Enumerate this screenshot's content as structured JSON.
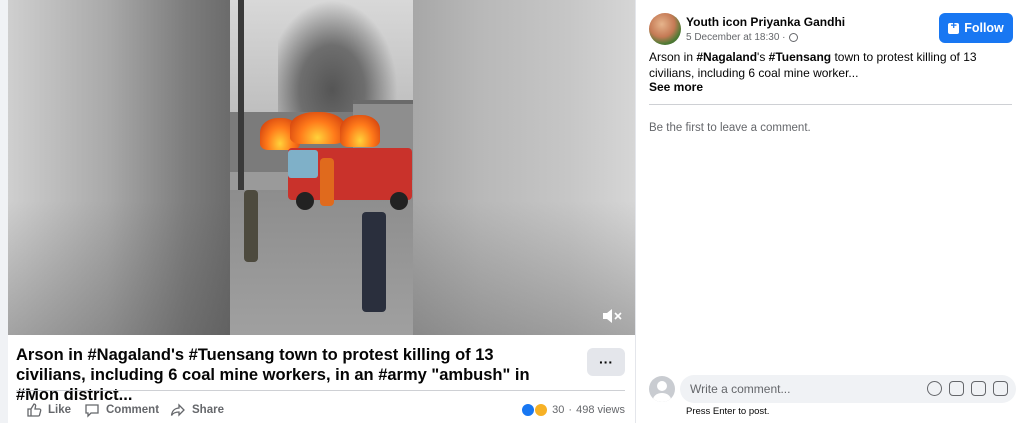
{
  "post": {
    "caption": "Arson in #Nagaland's #Tuensang town to protest killing of 13 civilians, including 6 coal mine workers, in an #army \"ambush\" in #Mon district...",
    "more_label": "···",
    "actions": {
      "like": "Like",
      "comment": "Comment",
      "share": "Share"
    },
    "reactions_count": "30",
    "separator": "·",
    "views": "498 views"
  },
  "sidebar": {
    "author": "Youth icon Priyanka Gandhi",
    "timestamp": "5 December at 18:30 ·",
    "follow_label": "Follow",
    "text_prefix": "Arson in ",
    "hashtag1": "#Nagaland",
    "text_mid": "'s ",
    "hashtag2": "#Tuensang",
    "text_suffix": " town to protest killing of 13 civilians, including 6 coal mine worker...",
    "see_more": "See more",
    "first_comment_hint": "Be the first to leave a comment.",
    "comment_placeholder": "Write a comment...",
    "press_enter_hint": "Press Enter to post."
  },
  "colors": {
    "accent": "#1877f2",
    "fire_truck": "#c9322b"
  },
  "icons": [
    "like-icon",
    "comment-icon",
    "share-icon",
    "mute-icon",
    "globe-icon",
    "emoji-icon",
    "camera-icon",
    "gif-icon",
    "sticker-icon"
  ]
}
